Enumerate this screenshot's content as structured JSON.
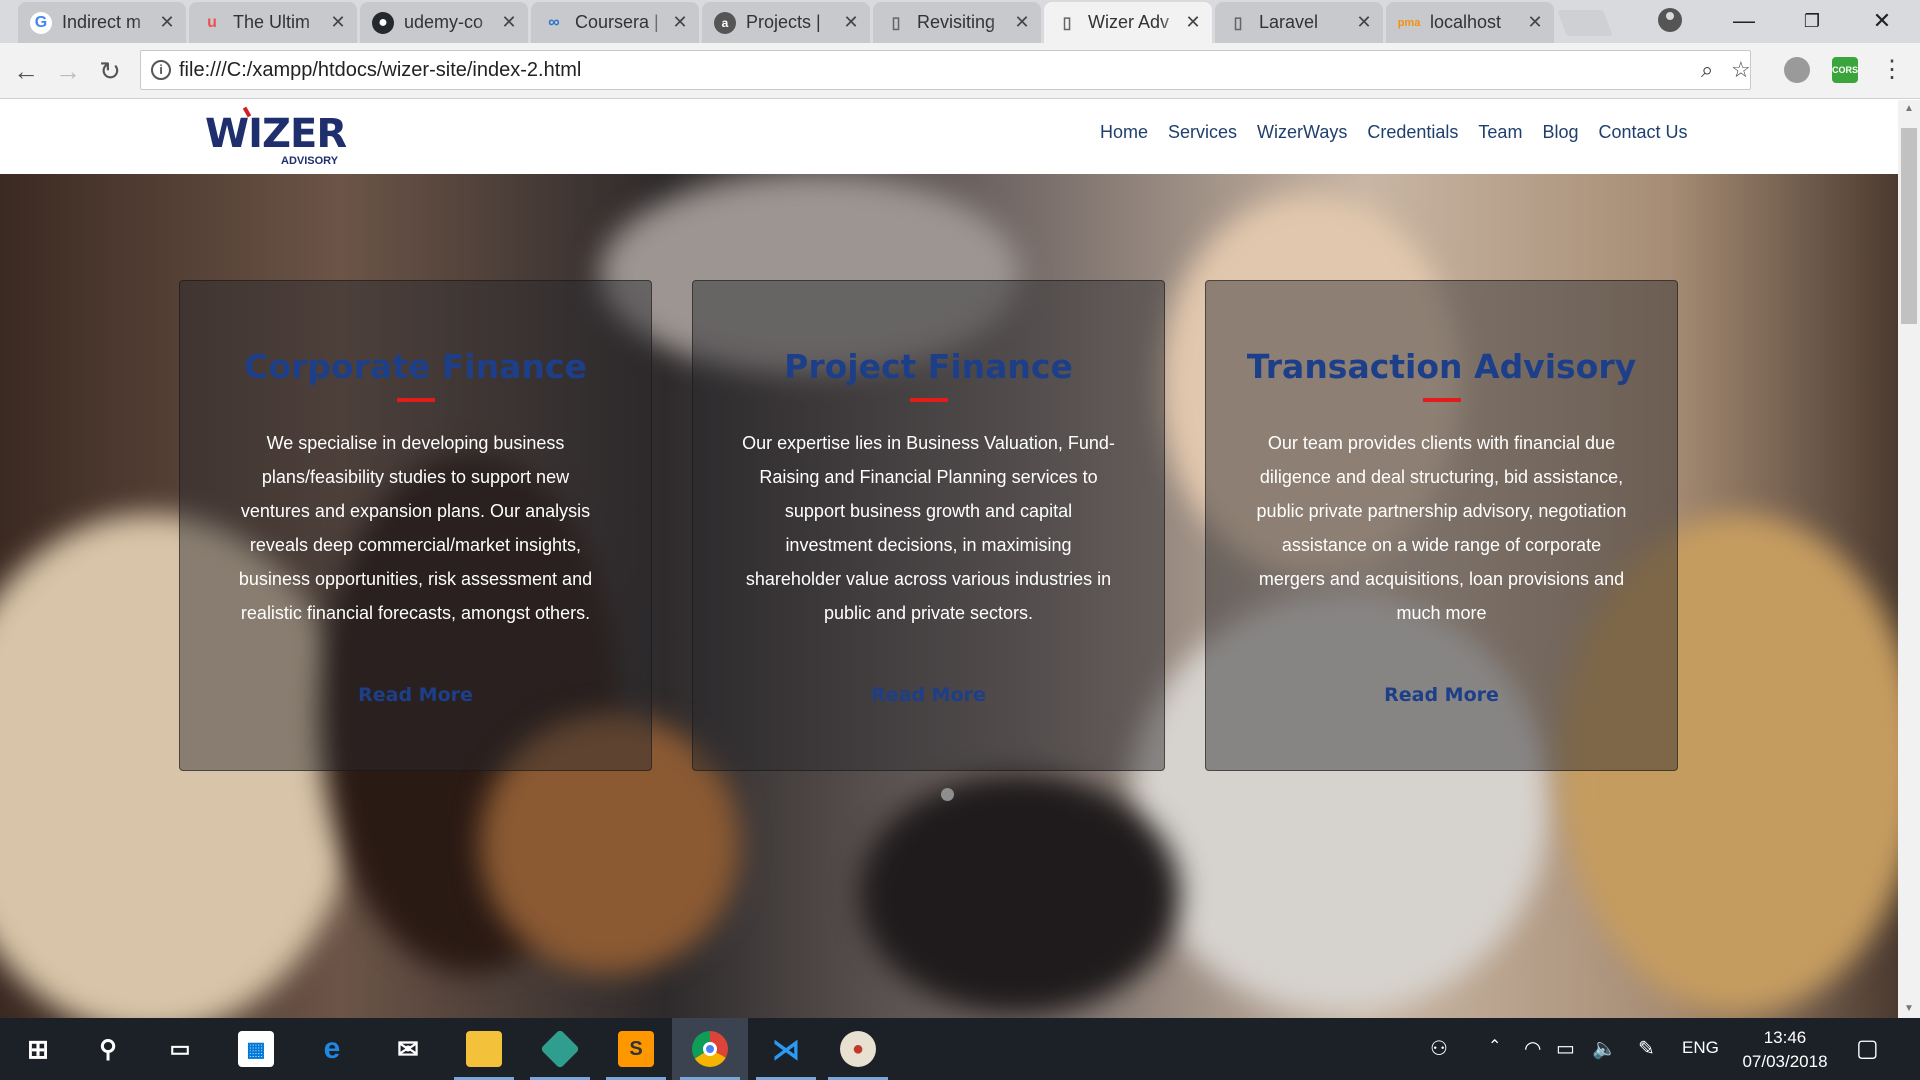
{
  "browser": {
    "tabs": [
      {
        "title": "Indirect m",
        "icon": "google-icon",
        "color": "#4285f4"
      },
      {
        "title": "The Ultim",
        "icon": "udemy-icon",
        "color": "#ec5252"
      },
      {
        "title": "udemy-co",
        "icon": "github-icon",
        "color": "#24292e"
      },
      {
        "title": "Coursera |",
        "icon": "coursera-icon",
        "color": "#2a73cc"
      },
      {
        "title": "Projects |",
        "icon": "projects-icon",
        "color": "#555555"
      },
      {
        "title": "Revisiting",
        "icon": "page-icon",
        "color": "#666666"
      },
      {
        "title": "Wizer Adv",
        "icon": "page-icon",
        "color": "#666666"
      },
      {
        "title": "Laravel",
        "icon": "page-icon",
        "color": "#666666"
      },
      {
        "title": "localhost",
        "icon": "phpmyadmin-icon",
        "color": "#f29111"
      }
    ],
    "active_tab": 6,
    "url": "file:///C:/xampp/htdocs/wizer-site/index-2.html",
    "extension_label": "CORS"
  },
  "site": {
    "logo": {
      "word": "WIZER",
      "sub": "ADVISORY"
    },
    "nav": [
      "Home",
      "Services",
      "WizerWays",
      "Credentials",
      "Team",
      "Blog",
      "Contact Us"
    ],
    "cards": [
      {
        "title": "Corporate Finance",
        "body": "We specialise in developing business plans/feasibility studies to support new ventures and expansion plans. Our analysis reveals deep commercial/market insights, business opportunities, risk assessment and realistic financial forecasts, amongst others.",
        "link": "Read More"
      },
      {
        "title": "Project Finance",
        "body": "Our expertise lies in Business Valuation, Fund-Raising and Financial Planning services to support business growth and capital investment decisions, in maximising shareholder value across various industries in public and private sectors.",
        "link": "Read More"
      },
      {
        "title": "Transaction Advisory",
        "body": "Our team provides clients with financial due diligence and deal structuring, bid assistance, public private partnership advisory, negotiation assistance on a wide range of corporate mergers and acquisitions, loan provisions and much more",
        "link": "Read More"
      }
    ],
    "colors": {
      "brand_navy": "#1d3f8a",
      "accent_red": "#e21b1b"
    }
  },
  "taskbar": {
    "apps": [
      {
        "name": "start-icon",
        "running": false
      },
      {
        "name": "search-icon",
        "running": false
      },
      {
        "name": "task-view-icon",
        "running": false
      },
      {
        "name": "store-icon",
        "running": false
      },
      {
        "name": "edge-icon",
        "running": false
      },
      {
        "name": "mail-icon",
        "running": false
      },
      {
        "name": "file-explorer-icon",
        "running": true
      },
      {
        "name": "git-kraken-icon",
        "running": true
      },
      {
        "name": "sublime-text-icon",
        "running": true
      },
      {
        "name": "chrome-icon",
        "running": true
      },
      {
        "name": "vscode-icon",
        "running": true
      },
      {
        "name": "paint-icon",
        "running": true
      }
    ],
    "language": "ENG",
    "time": "13:46",
    "date": "07/03/2018"
  }
}
